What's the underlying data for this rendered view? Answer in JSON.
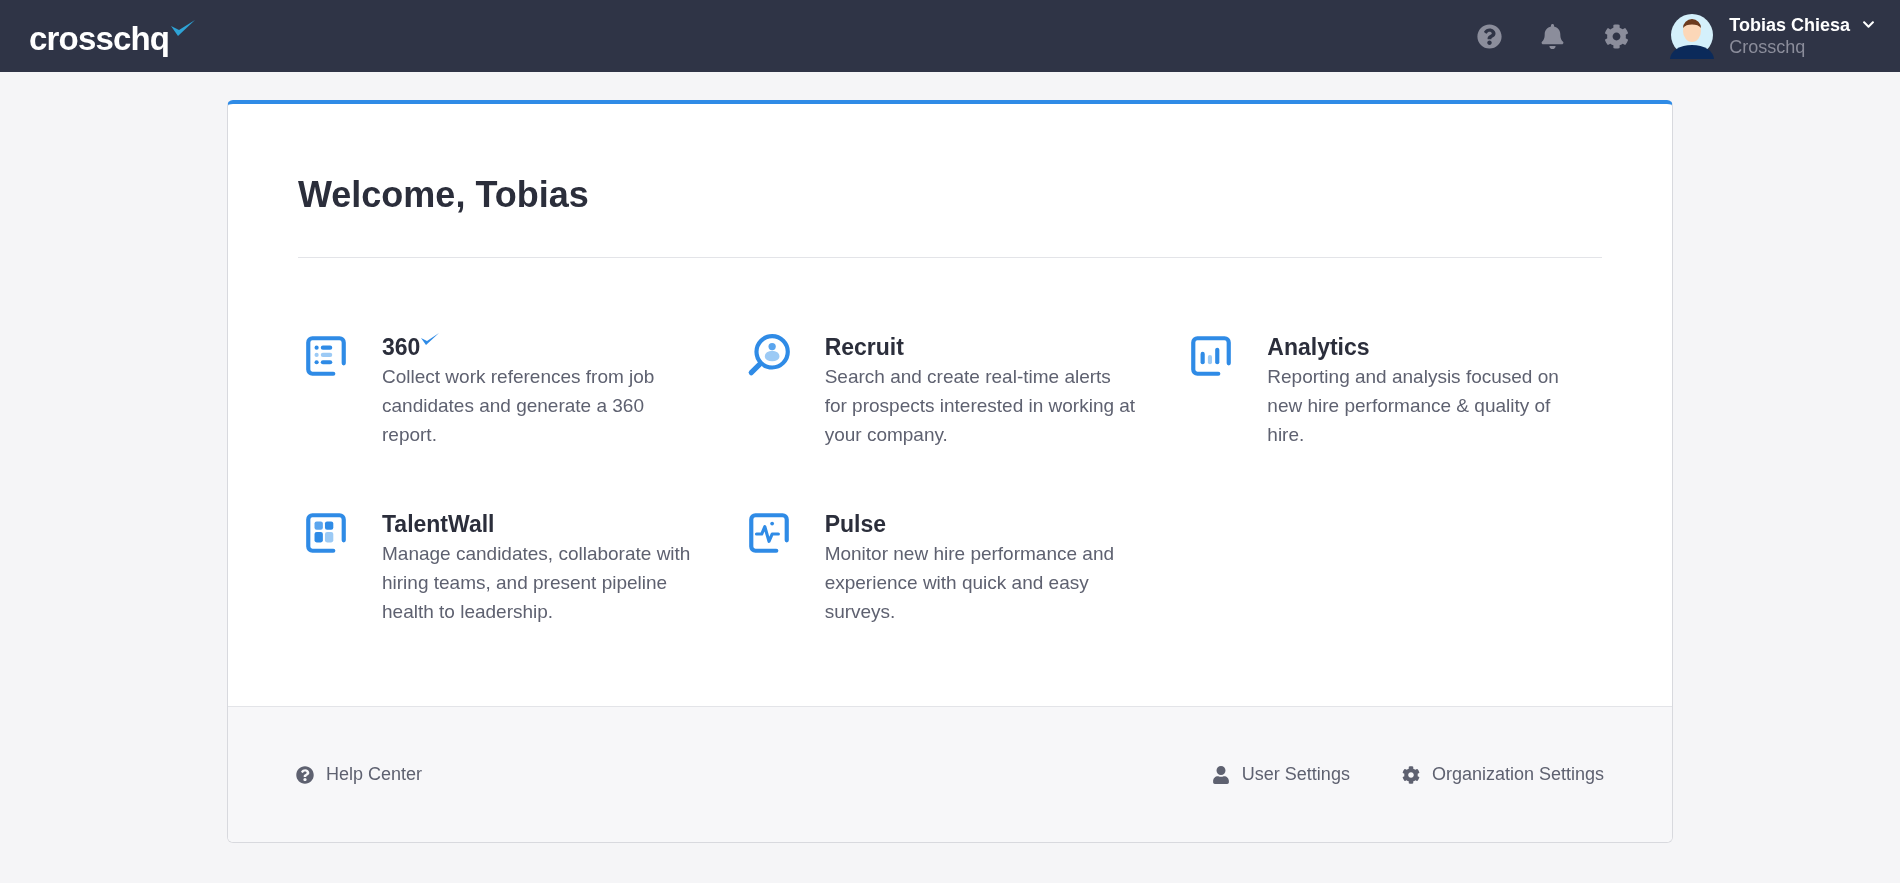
{
  "header": {
    "logo": "crosschq",
    "user": {
      "name": "Tobias Chiesa",
      "org": "Crosschq"
    }
  },
  "welcome": {
    "title": "Welcome, Tobias"
  },
  "products": [
    {
      "kind": "list",
      "title": "360",
      "check_mark": true,
      "description": "Collect work references from job candidates and generate a 360 report."
    },
    {
      "kind": "search",
      "title": "Recruit",
      "check_mark": false,
      "description": "Search and create real-time alerts for prospects interested in working at your company."
    },
    {
      "kind": "chart",
      "title": "Analytics",
      "check_mark": false,
      "description": "Reporting and analysis focused on new hire performance & quality of hire."
    },
    {
      "kind": "grid",
      "title": "TalentWall",
      "check_mark": false,
      "description": "Manage candidates, collaborate with hiring teams, and present pipeline health to leadership."
    },
    {
      "kind": "pulse",
      "title": "Pulse",
      "check_mark": false,
      "description": "Monitor new hire performance and experience with quick and easy surveys."
    }
  ],
  "footer": {
    "links": [
      {
        "kind": "help",
        "label": "Help Center"
      },
      {
        "kind": "user",
        "label": "User Settings"
      },
      {
        "kind": "gear",
        "label": "Organization Settings"
      }
    ]
  }
}
